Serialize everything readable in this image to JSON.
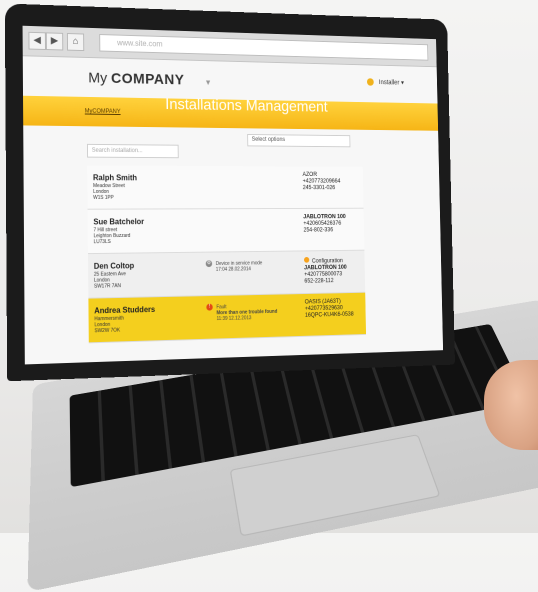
{
  "browser": {
    "url": "www.site.com"
  },
  "header": {
    "brand_prefix": "My",
    "brand_name": "COMPANY",
    "user_label": "Installer"
  },
  "banner": {
    "breadcrumb": "MyCOMPANY",
    "title": "Installations Management"
  },
  "filters": {
    "search_placeholder": "Search installation...",
    "select_label": "Select options"
  },
  "installations": [
    {
      "name": "Ralph Smith",
      "address": [
        "Meadow Street",
        "London",
        "W1S 1PP"
      ],
      "status": "",
      "right": [
        "AZOR",
        "+420773209664",
        "245-3301-026"
      ]
    },
    {
      "name": "Sue Batchelor",
      "address": [
        "7 Hill street",
        "Leighton Buzzard",
        "LU73LS"
      ],
      "status": "",
      "right": [
        "JABLOTRON 100",
        "+420605426376",
        "254-802-336"
      ]
    },
    {
      "name": "Den Coltop",
      "address": [
        "25 Eastern Ave",
        "London",
        "SW17R 7AN"
      ],
      "status": "Device in service mode",
      "status_time": "17:04 28.02.2014",
      "right_status": "Configuration",
      "right": [
        "JABLOTRON 100",
        "+420775800073",
        "652-228-112"
      ]
    },
    {
      "name": "Andrea Studders",
      "address": [
        "Hammersmith",
        "London",
        "SW2W 7OK"
      ],
      "status": "Fault",
      "status_detail": "More than one trouble found",
      "status_time": "11:39 12.12.2013",
      "right": [
        "OASIS (JA63T)",
        "+420773529630",
        "16QPC-KU4K6-0538"
      ]
    }
  ],
  "colors": {
    "accent": "#f6b516",
    "highlight_row": "#f4cf1e",
    "fault_badge": "#e24a16"
  }
}
